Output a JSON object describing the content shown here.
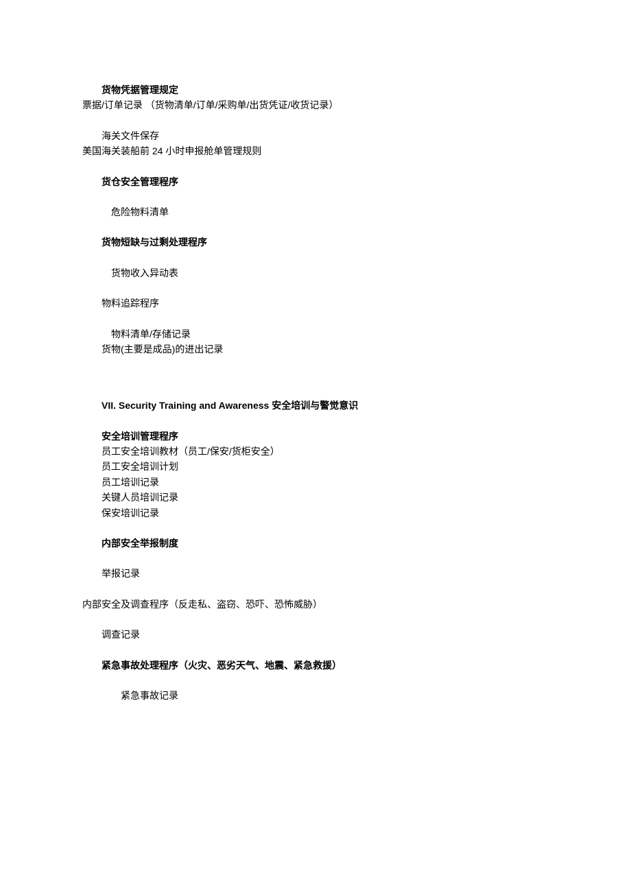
{
  "lines": {
    "l1": "货物凭据管理规定",
    "l2": "票据/订单记录 （货物清单/订单/采购单/出货凭证/收货记录）",
    "l3": "海关文件保存",
    "l4": "美国海关装船前 24 小时申报舱单管理规则",
    "l5": "货仓安全管理程序",
    "l6": "危险物料清单",
    "l7": "货物短缺与过剩处理程序",
    "l8": "货物收入异动表",
    "l9": "物料追踪程序",
    "l10": "物料清单/存储记录",
    "l11": "货物(主要是成品)的进出记录",
    "section7": "VII. Security Training and Awareness  安全培训与警觉意识",
    "l12": " 安全培训管理程序",
    "l13": "员工安全培训教材（员工/保安/货柜安全）",
    "l14": "员工安全培训计划",
    "l15": "员工培训记录",
    "l16": "关键人员培训记录",
    "l17": "保安培训记录",
    "l18": "内部安全举报制度",
    "l19": "举报记录",
    "l20": "内部安全及调查程序（反走私、盗窃、恐吓、恐怖威胁）",
    "l21": "调查记录",
    "l22": "紧急事故处理程序（火灾、恶劣天气、地震、紧急救援）",
    "l23": "紧急事故记录"
  }
}
